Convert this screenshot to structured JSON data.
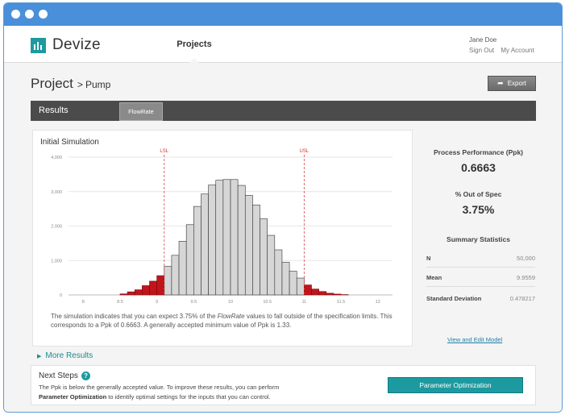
{
  "app": {
    "name": "Devize",
    "nav_projects": "Projects"
  },
  "user": {
    "name": "Jane Doe",
    "sign_out": "Sign Out",
    "my_account": "My Account"
  },
  "breadcrumb": {
    "title": "Project",
    "separator": ">",
    "sub": "Pump"
  },
  "toolbar": {
    "export_label": "Export"
  },
  "results": {
    "title": "Results",
    "tab": "FlowRate"
  },
  "card": {
    "title": "Initial Simulation",
    "desc_1": "The simulation indicates that you can expect 3.75% of the ",
    "desc_em": "FlowRate",
    "desc_2": " values to fall outside of the specification limits. This corresponds to a Ppk of 0.6663. A generally accepted minimum value of Ppk is 1.33."
  },
  "chart_data": {
    "type": "bar",
    "title": "",
    "xlabel": "",
    "ylabel": "",
    "xlim": [
      7.8,
      12.2
    ],
    "ylim": [
      0,
      4000
    ],
    "x_ticks": [
      "8",
      "8.5",
      "9",
      "9.5",
      "10",
      "10.5",
      "11",
      "11.5",
      "12"
    ],
    "y_ticks": [
      "0",
      "1,000",
      "2,000",
      "3,000",
      "4,000"
    ],
    "spec_limits": [
      {
        "label": "LSL",
        "x": 9.1
      },
      {
        "label": "USL",
        "x": 11.0
      }
    ],
    "bin_width": 0.1,
    "bin_starts": [
      8.5,
      8.6,
      8.7,
      8.8,
      8.9,
      9.0,
      9.1,
      9.2,
      9.3,
      9.4,
      9.5,
      9.6,
      9.7,
      9.8,
      9.9,
      10.0,
      10.1,
      10.2,
      10.3,
      10.4,
      10.5,
      10.6,
      10.7,
      10.8,
      10.9,
      11.0,
      11.1,
      11.2,
      11.3,
      11.4,
      11.5
    ],
    "counts": [
      30,
      90,
      150,
      270,
      400,
      560,
      830,
      1150,
      1560,
      2040,
      2570,
      2930,
      3190,
      3330,
      3350,
      3350,
      3180,
      2890,
      2610,
      2210,
      1730,
      1310,
      950,
      690,
      490,
      290,
      170,
      100,
      50,
      25,
      10
    ],
    "colors": {
      "in_spec": "#d6d6d6",
      "out_of_spec": "#c0151b",
      "grid": "#e6e6e6",
      "spec_line": "#d44"
    }
  },
  "side": {
    "ppk_label": "Process Performance (Ppk)",
    "ppk_value": "0.6663",
    "out_label": "% Out of Spec",
    "out_value": "3.75%",
    "summary_title": "Summary Statistics",
    "stats": [
      {
        "label": "N",
        "value": "50,000"
      },
      {
        "label": "Mean",
        "value": "9.9559"
      },
      {
        "label": "Standard Deviation",
        "value": "0.478217"
      }
    ],
    "view_link": "View and Edit Model"
  },
  "more_results": "More Results",
  "next_steps": {
    "title": "Next Steps",
    "line1": "The Ppk is below the generally accepted value. To improve these results, you can perform",
    "line2_bold": "Parameter Optimization",
    "line2_rest": " to identify optimal settings for the inputs that you can control.",
    "button": "Parameter Optimization"
  },
  "colors": {
    "titlebar": "#4a8fd9",
    "accent": "#1d9aa0"
  }
}
